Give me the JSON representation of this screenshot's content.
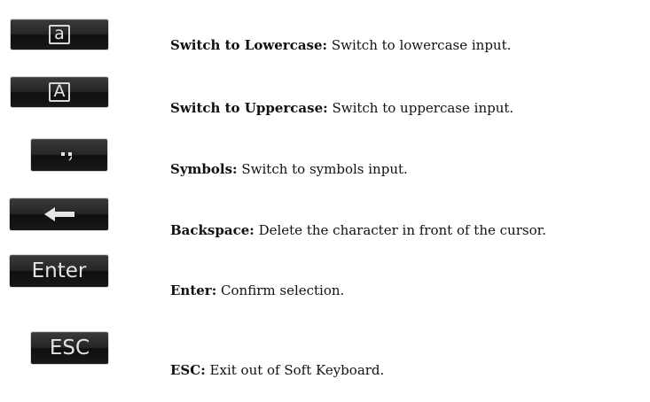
{
  "items": [
    {
      "key_label": "a",
      "term": "Switch to Lowercase:",
      "description": "Switch to lowercase input."
    },
    {
      "key_label": "A",
      "term": "Switch to Uppercase:",
      "description": "Switch to uppercase input."
    },
    {
      "key_label": ".,",
      "icon": "punctuation-symbols-icon",
      "term": "Symbols:",
      "description": "Switch to symbols input."
    },
    {
      "icon": "left-arrow-icon",
      "term": "Backspace:",
      "description": "Delete the character in front of the cursor."
    },
    {
      "key_label": "Enter",
      "term": "Enter:",
      "description": "Confirm selection."
    },
    {
      "key_label": "ESC",
      "term": "ESC:",
      "description": "Exit out of Soft Keyboard."
    }
  ]
}
